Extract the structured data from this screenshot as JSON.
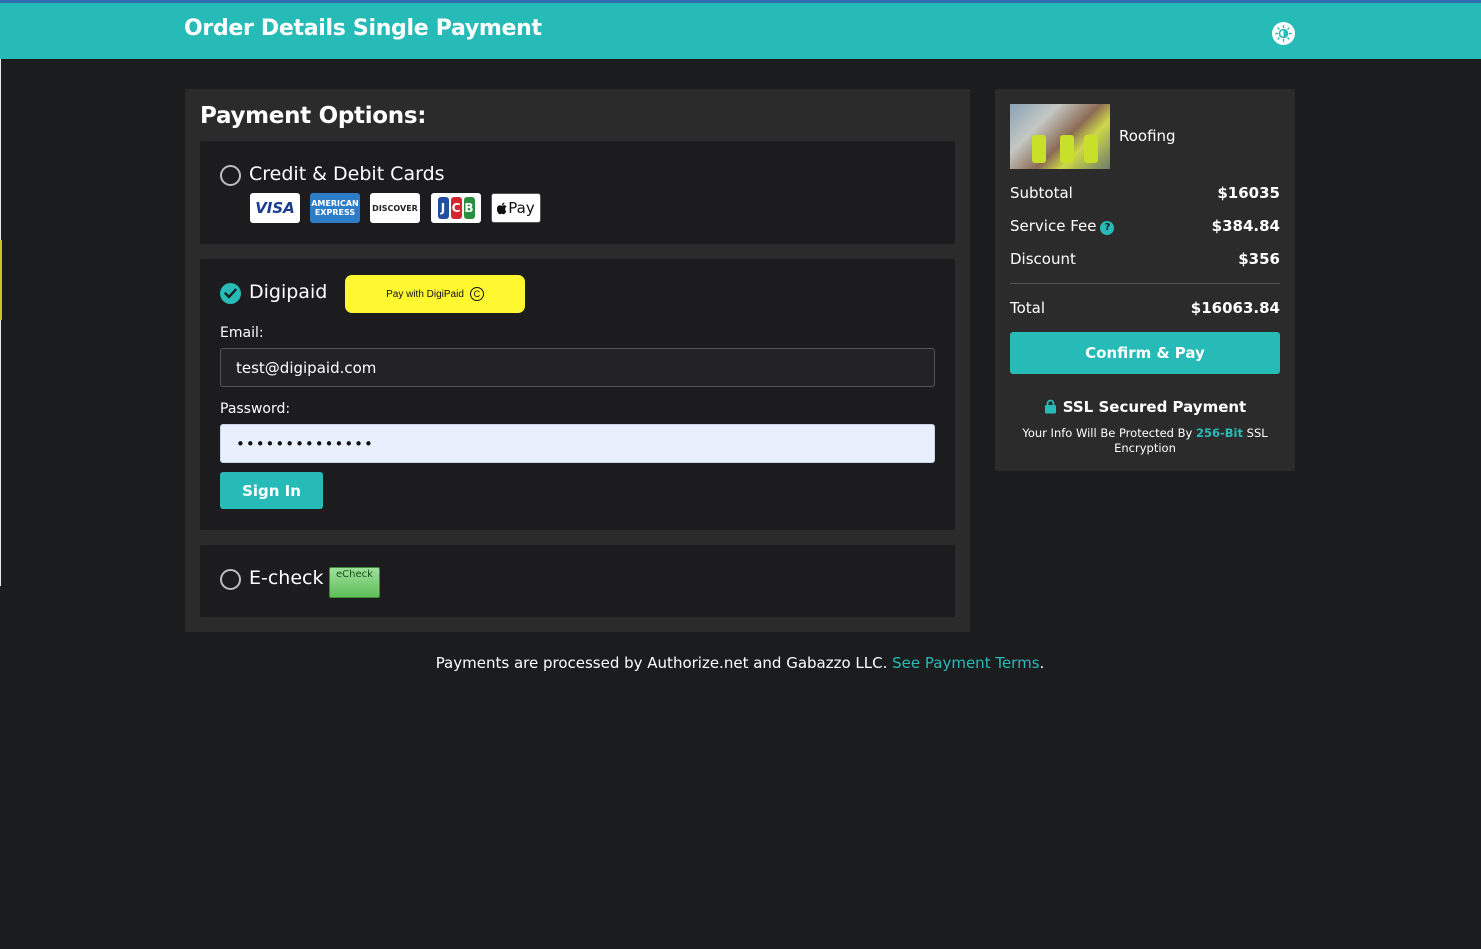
{
  "header": {
    "title": "Order Details Single Payment",
    "theme_icon": "sun-toggle-icon"
  },
  "payment_options": {
    "heading": "Payment Options:",
    "credit": {
      "label": "Credit & Debit Cards",
      "brands": {
        "visa": "VISA",
        "amex_line1": "AMERICAN",
        "amex_line2": "EXPRESS",
        "discover": "DISCOVER",
        "jcb": [
          "J",
          "C",
          "B"
        ],
        "applepay": "Pay"
      },
      "selected": false
    },
    "digipaid": {
      "label": "Digipaid",
      "selected": true,
      "pay_button": "Pay with DigiPaid",
      "email_label": "Email:",
      "email_value": "test@digipaid.com",
      "password_label": "Password:",
      "password_value": "••••••••••••••",
      "signin_label": "Sign In"
    },
    "echeck": {
      "label": "E-check",
      "badge_text": "eCheck",
      "selected": false
    }
  },
  "summary": {
    "product_name": "Roofing",
    "subtotal_label": "Subtotal",
    "subtotal_value": "$16035",
    "fee_label": "Service Fee",
    "fee_value": "$384.84",
    "discount_label": "Discount",
    "discount_value": "$356",
    "total_label": "Total",
    "total_value": "$16063.84",
    "confirm_label": "Confirm & Pay",
    "ssl_title": "SSL Secured Payment",
    "ssl_note_pre": "Your Info Will Be Protected By ",
    "ssl_note_hl": "256-Bit",
    "ssl_note_post": " SSL Encryption"
  },
  "footer": {
    "text": "Payments are processed by Authorize.net and Gabazzo LLC. ",
    "link": "See Payment Terms",
    "end": "."
  },
  "colors": {
    "accent": "#27bbb8",
    "background": "#1b1c1e",
    "panel": "#2b2b2c",
    "digipaid_yellow": "#fff831"
  }
}
